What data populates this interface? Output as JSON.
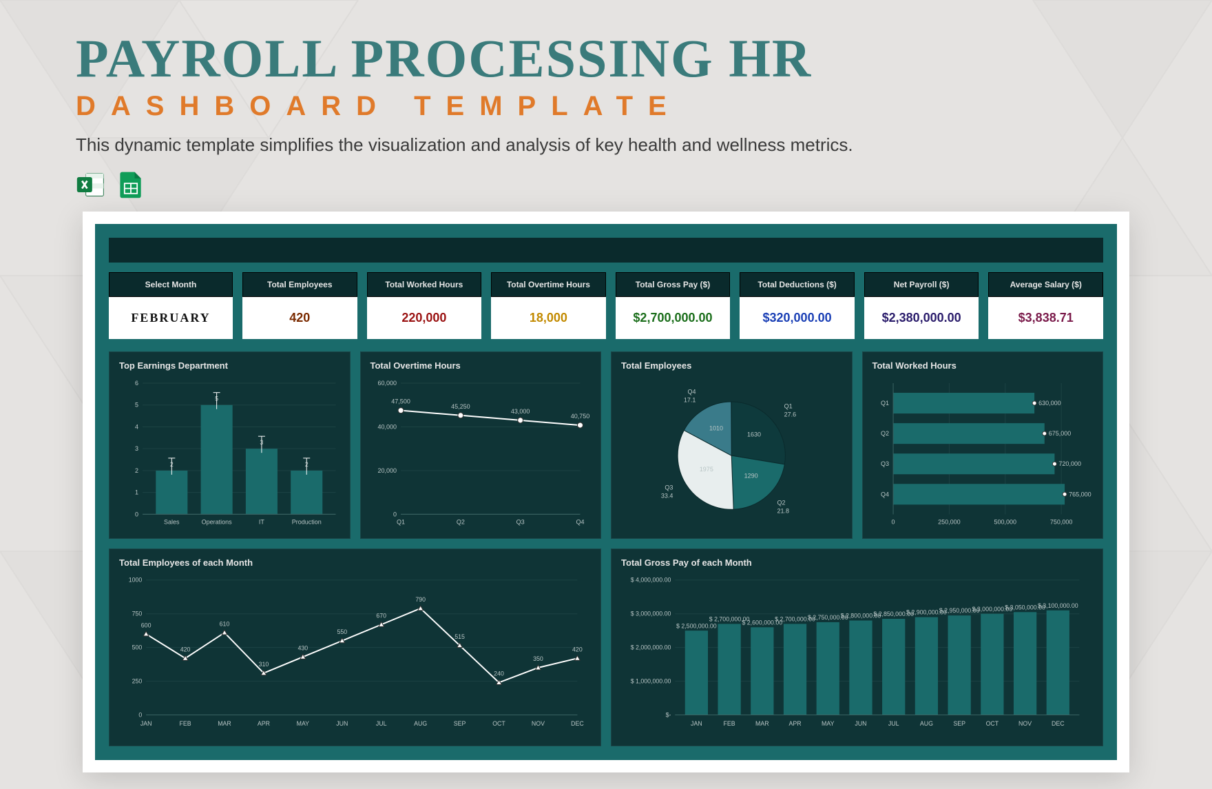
{
  "header": {
    "title_line1": "PAYROLL PROCESSING HR",
    "title_line2": "DASHBOARD TEMPLATE",
    "description": "This dynamic template simplifies the visualization and analysis of key health and wellness metrics."
  },
  "icons": {
    "excel": "excel-icon",
    "sheets": "google-sheets-icon"
  },
  "selector": {
    "label": "Select Month",
    "value": "FEBRUARY"
  },
  "kpis": [
    {
      "label": "Total Employees",
      "value": "420",
      "color": "#7A2A00"
    },
    {
      "label": "Total Worked Hours",
      "value": "220,000",
      "color": "#9A1212"
    },
    {
      "label": "Total Overtime Hours",
      "value": "18,000",
      "color": "#C28A00"
    },
    {
      "label": "Total Gross Pay ($)",
      "value": "$2,700,000.00",
      "color": "#1B6E1B"
    },
    {
      "label": "Total Deductions ($)",
      "value": "$320,000.00",
      "color": "#1A3FB5"
    },
    {
      "label": "Net Payroll ($)",
      "value": "$2,380,000.00",
      "color": "#2A1C6B"
    },
    {
      "label": "Average Salary ($)",
      "value": "$3,838.71",
      "color": "#7A1A4A"
    }
  ],
  "chart_data": [
    {
      "id": "top_earnings",
      "type": "bar",
      "title": "Top Earnings Department",
      "categories": [
        "Sales",
        "Operations",
        "IT",
        "Production"
      ],
      "values": [
        2,
        5,
        3,
        2
      ],
      "ylim": [
        0,
        6
      ]
    },
    {
      "id": "ot_hours",
      "type": "line",
      "title": "Total Overtime Hours",
      "categories": [
        "Q1",
        "Q2",
        "Q3",
        "Q4"
      ],
      "values": [
        47500,
        45250,
        43000,
        40750
      ],
      "y_ticks": [
        0,
        20000,
        40000,
        60000
      ],
      "ylim": [
        0,
        60000
      ]
    },
    {
      "id": "total_employees_pie",
      "type": "pie",
      "title": "Total Employees",
      "slices": [
        {
          "label": "Q1",
          "value": 1630,
          "pct": 27.6,
          "color": "#0E3A3C"
        },
        {
          "label": "Q2",
          "value": 1290,
          "pct": 21.8,
          "color": "#1A6B6B"
        },
        {
          "label": "Q3",
          "value": 1975,
          "pct": 33.4,
          "color": "#E8EEEE"
        },
        {
          "label": "Q4",
          "value": 1010,
          "pct": 17.1,
          "color": "#3A7B8A"
        }
      ]
    },
    {
      "id": "worked_hours",
      "type": "bar",
      "orientation": "horizontal",
      "title": "Total Worked Hours",
      "categories": [
        "Q1",
        "Q2",
        "Q3",
        "Q4"
      ],
      "values": [
        630000,
        675000,
        720000,
        765000
      ],
      "x_ticks": [
        0,
        250000,
        500000,
        750000
      ],
      "xlim": [
        0,
        800000
      ]
    },
    {
      "id": "employees_monthly",
      "type": "line",
      "title": "Total Employees of each Month",
      "categories": [
        "JAN",
        "FEB",
        "MAR",
        "APR",
        "MAY",
        "JUN",
        "JUL",
        "AUG",
        "SEP",
        "OCT",
        "NOV",
        "DEC"
      ],
      "values": [
        600,
        420,
        610,
        310,
        430,
        550,
        670,
        790,
        515,
        240,
        350,
        420
      ],
      "y_ticks": [
        0,
        250,
        500,
        750,
        1000
      ],
      "ylim": [
        0,
        1000
      ]
    },
    {
      "id": "gross_monthly",
      "type": "bar",
      "orientation": "vertical",
      "title": "Total Gross Pay of each Month",
      "categories": [
        "JAN",
        "FEB",
        "MAR",
        "APR",
        "MAY",
        "JUN",
        "JUL",
        "AUG",
        "SEP",
        "OCT",
        "NOV",
        "DEC"
      ],
      "values": [
        2500000,
        2700000,
        2600000,
        2700000,
        2750000,
        2800000,
        2850000,
        2900000,
        2950000,
        3000000,
        3050000,
        3100000
      ],
      "labels": [
        "$ 2,500,000.00",
        "$ 2,700,000.00",
        "$ 2,600,000.00",
        "$ 2,700,000.00",
        "$ 2,750,000.00",
        "$ 2,800,000.00",
        "$ 2,850,000.00",
        "$ 2,900,000.00",
        "$ 2,950,000.00",
        "$ 3,000,000.00",
        "$ 3,050,000.00",
        "$ 3,100,000.00"
      ],
      "y_ticks": [
        "$-",
        "$ 1,000,000.00",
        "$ 2,000,000.00",
        "$ 3,000,000.00",
        "$ 4,000,000.00"
      ],
      "ylim": [
        0,
        4000000
      ]
    }
  ]
}
